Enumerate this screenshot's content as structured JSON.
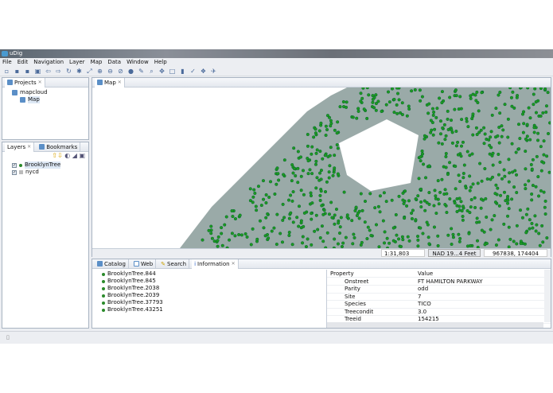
{
  "window": {
    "title": "uDig"
  },
  "menu": [
    "File",
    "Edit",
    "Navigation",
    "Layer",
    "Map",
    "Data",
    "Window",
    "Help"
  ],
  "toolbar_icons": [
    "new-icon",
    "save-icon",
    "save-all-icon",
    "print-icon",
    "back-icon",
    "forward-icon",
    "refresh-icon",
    "layer-icon",
    "zoom-extent-icon",
    "zoom-in-icon",
    "zoom-out-icon",
    "zoom-prev-icon",
    "pan-icon",
    "edit-icon",
    "search-icon",
    "move-icon",
    "select-icon",
    "info-icon",
    "draw-icon",
    "style-icon",
    "tool-icon"
  ],
  "projects": {
    "tab": "Projects",
    "project": "mapcloud",
    "map": "Map"
  },
  "layers": {
    "tabs": [
      "Layers",
      "Bookmarks"
    ],
    "items": [
      {
        "name": "BrooklynTree",
        "checked": true
      },
      {
        "name": "nycd",
        "checked": true
      }
    ]
  },
  "map": {
    "tab": "Map",
    "scale": "1:31,803",
    "crs": "NAD 19...4 Feet",
    "coords": "967838, 174404",
    "land_color": "#9aaaa8",
    "dot_color": "#1f9a1f"
  },
  "bottom": {
    "tabs": [
      "Catalog",
      "Web",
      "Search",
      "Information"
    ],
    "features": [
      "BrooklynTree.844",
      "BrooklynTree.845",
      "BrooklynTree.2038",
      "BrooklynTree.2039",
      "BrooklynTree.37793",
      "BrooklynTree.43251"
    ],
    "prop_header": {
      "property": "Property",
      "value": "Value"
    },
    "properties": [
      {
        "k": "Onstreet",
        "v": "FT HAMILTON PARKWAY"
      },
      {
        "k": "Parity",
        "v": "odd"
      },
      {
        "k": "Site",
        "v": "7"
      },
      {
        "k": "Species",
        "v": "TICO"
      },
      {
        "k": "Treecondit",
        "v": "3.0"
      },
      {
        "k": "Treeid",
        "v": "154215"
      }
    ]
  }
}
